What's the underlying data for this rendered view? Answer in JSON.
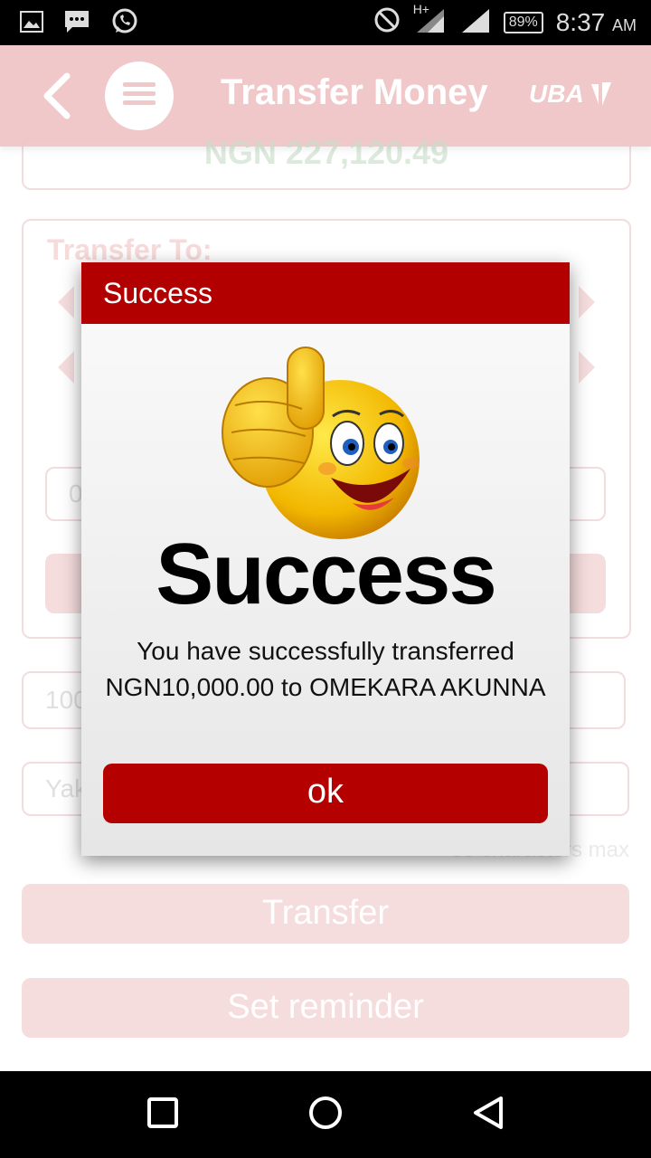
{
  "status_bar": {
    "network_label": "H+",
    "battery": "89%",
    "time": "8:37",
    "ampm": "AM"
  },
  "appbar": {
    "title": "Transfer Money",
    "logo_text": "UBA"
  },
  "background_form": {
    "balance": "NGN 227,120.49",
    "transfer_to_label": "Transfer To:",
    "account_field_partial": "0",
    "amount_field_partial": "100",
    "narration_field_partial": "Yak",
    "max_note": "30 characters max",
    "transfer_button": "Transfer",
    "reminder_button": "Set reminder"
  },
  "dialog": {
    "header": "Success",
    "heading": "Success",
    "message": "You have successfully transferred NGN10,000.00 to OMEKARA AKUNNA",
    "ok_label": "ok"
  },
  "colors": {
    "brand_red": "#b20000",
    "appbar_pink": "#f0c8c9"
  },
  "icons": [
    "gallery-icon",
    "chat-icon",
    "whatsapp-icon",
    "do-not-disturb-icon",
    "signal-icon",
    "back-arrow-icon",
    "menu-icon",
    "uba-logo",
    "recents-icon",
    "home-icon",
    "back-nav-icon"
  ]
}
